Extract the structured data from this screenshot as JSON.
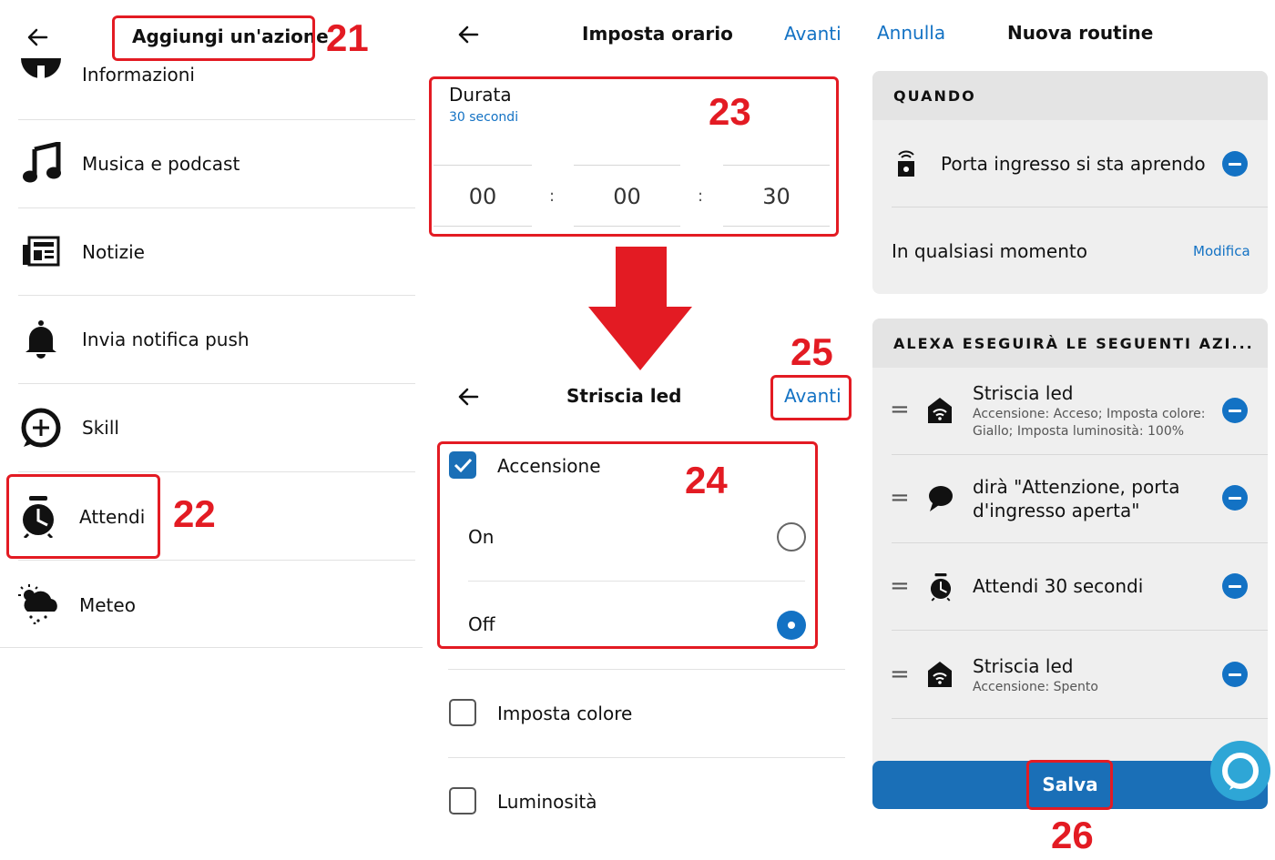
{
  "panel1": {
    "title": "Aggiungi un'azione",
    "items": [
      "Informazioni",
      "Musica e podcast",
      "Notizie",
      "Invia notifica push",
      "Skill",
      "Attendi",
      "Meteo"
    ]
  },
  "panel2": {
    "title": "Imposta orario",
    "next": "Avanti",
    "duration_label": "Durata",
    "duration_value": "30 secondi",
    "hours": "00",
    "minutes": "00",
    "seconds": "30",
    "sep": ":"
  },
  "panel3": {
    "title": "Striscia led",
    "next": "Avanti",
    "power_label": "Accensione",
    "on_label": "On",
    "off_label": "Off",
    "color_label": "Imposta colore",
    "brightness_label": "Luminosità"
  },
  "panel4": {
    "cancel": "Annulla",
    "title": "Nuova routine",
    "when_header": "QUANDO",
    "trigger": "Porta ingresso si sta aprendo",
    "anytime": "In qualsiasi momento",
    "modify": "Modifica",
    "actions_header": "ALEXA ESEGUIRÀ LE SEGUENTI AZI...",
    "actions": [
      {
        "title": "Striscia led",
        "detail_line1": "Accensione: Acceso; Imposta colore:",
        "detail_line2": "Giallo; Imposta luminosità: 100%"
      },
      {
        "title_line1": "dirà \"Attenzione, porta",
        "title_line2": "d'ingresso aperta\""
      },
      {
        "title": "Attendi 30 secondi"
      },
      {
        "title": "Striscia led",
        "detail_line1": "Accensione: Spento"
      }
    ],
    "drag_handle": "=",
    "save": "Salva"
  },
  "annotations": [
    "21",
    "22",
    "23",
    "24",
    "25",
    "26"
  ],
  "colors": {
    "accent_blue": "#1372c4",
    "annotation_red": "#e31b23",
    "save_button": "#1a6fb7"
  }
}
